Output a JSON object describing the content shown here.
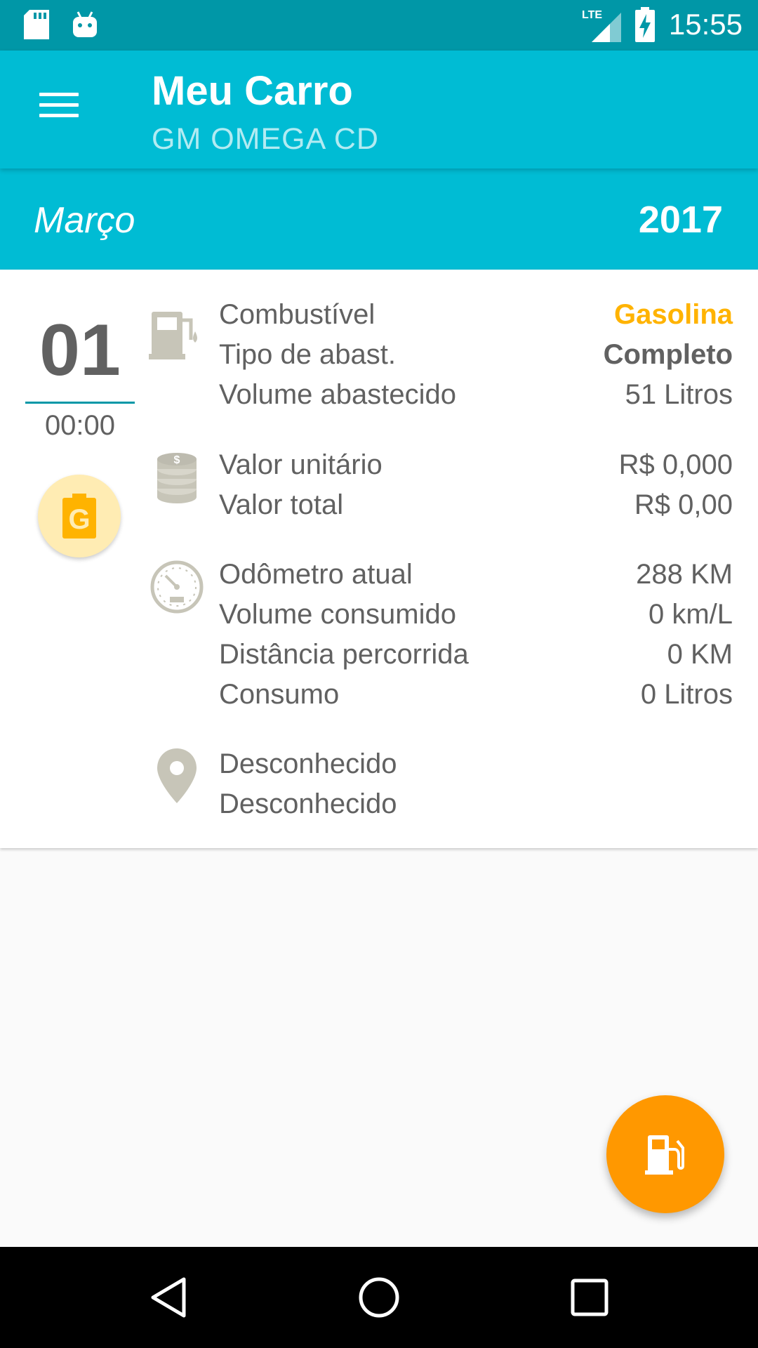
{
  "status_bar": {
    "time": "15:55",
    "network": "LTE",
    "icons": [
      "sd-card-icon",
      "android-icon",
      "signal-icon",
      "battery-charging-icon"
    ]
  },
  "app_bar": {
    "title": "Meu Carro",
    "subtitle": "GM OMEGA CD",
    "menu_icon": "hamburger-menu-icon"
  },
  "month_header": {
    "month": "Março",
    "year": "2017"
  },
  "entry": {
    "day": "01",
    "time": "00:00",
    "fuel_badge_letter": "G",
    "fuel_group": [
      {
        "label": "Combustível",
        "value": "Gasolina"
      },
      {
        "label": "Tipo de abast.",
        "value": "Completo"
      },
      {
        "label": "Volume abastecido",
        "value": "51 Litros"
      }
    ],
    "cost_group": [
      {
        "label": "Valor unitário",
        "value": "R$ 0,000"
      },
      {
        "label": "Valor total",
        "value": "R$ 0,00"
      }
    ],
    "odometer_group": [
      {
        "label": "Odômetro atual",
        "value": "288 KM"
      },
      {
        "label": "Volume consumido",
        "value": "0 km/L"
      },
      {
        "label": "Distância percorrida",
        "value": "0 KM"
      },
      {
        "label": "Consumo",
        "value": "0 Litros"
      }
    ],
    "location_group": [
      {
        "label": "Desconhecido"
      },
      {
        "label": "Desconhecido"
      }
    ]
  },
  "fab": {
    "icon": "fuel-pump-icon"
  },
  "colors": {
    "status_bar": "#0097a7",
    "primary": "#00bcd4",
    "accent": "#ff9800",
    "fuel_text": "#ffb300",
    "badge_bg": "#ffecb3",
    "icon_gray": "#c7c5b8",
    "text_gray": "#616161"
  }
}
